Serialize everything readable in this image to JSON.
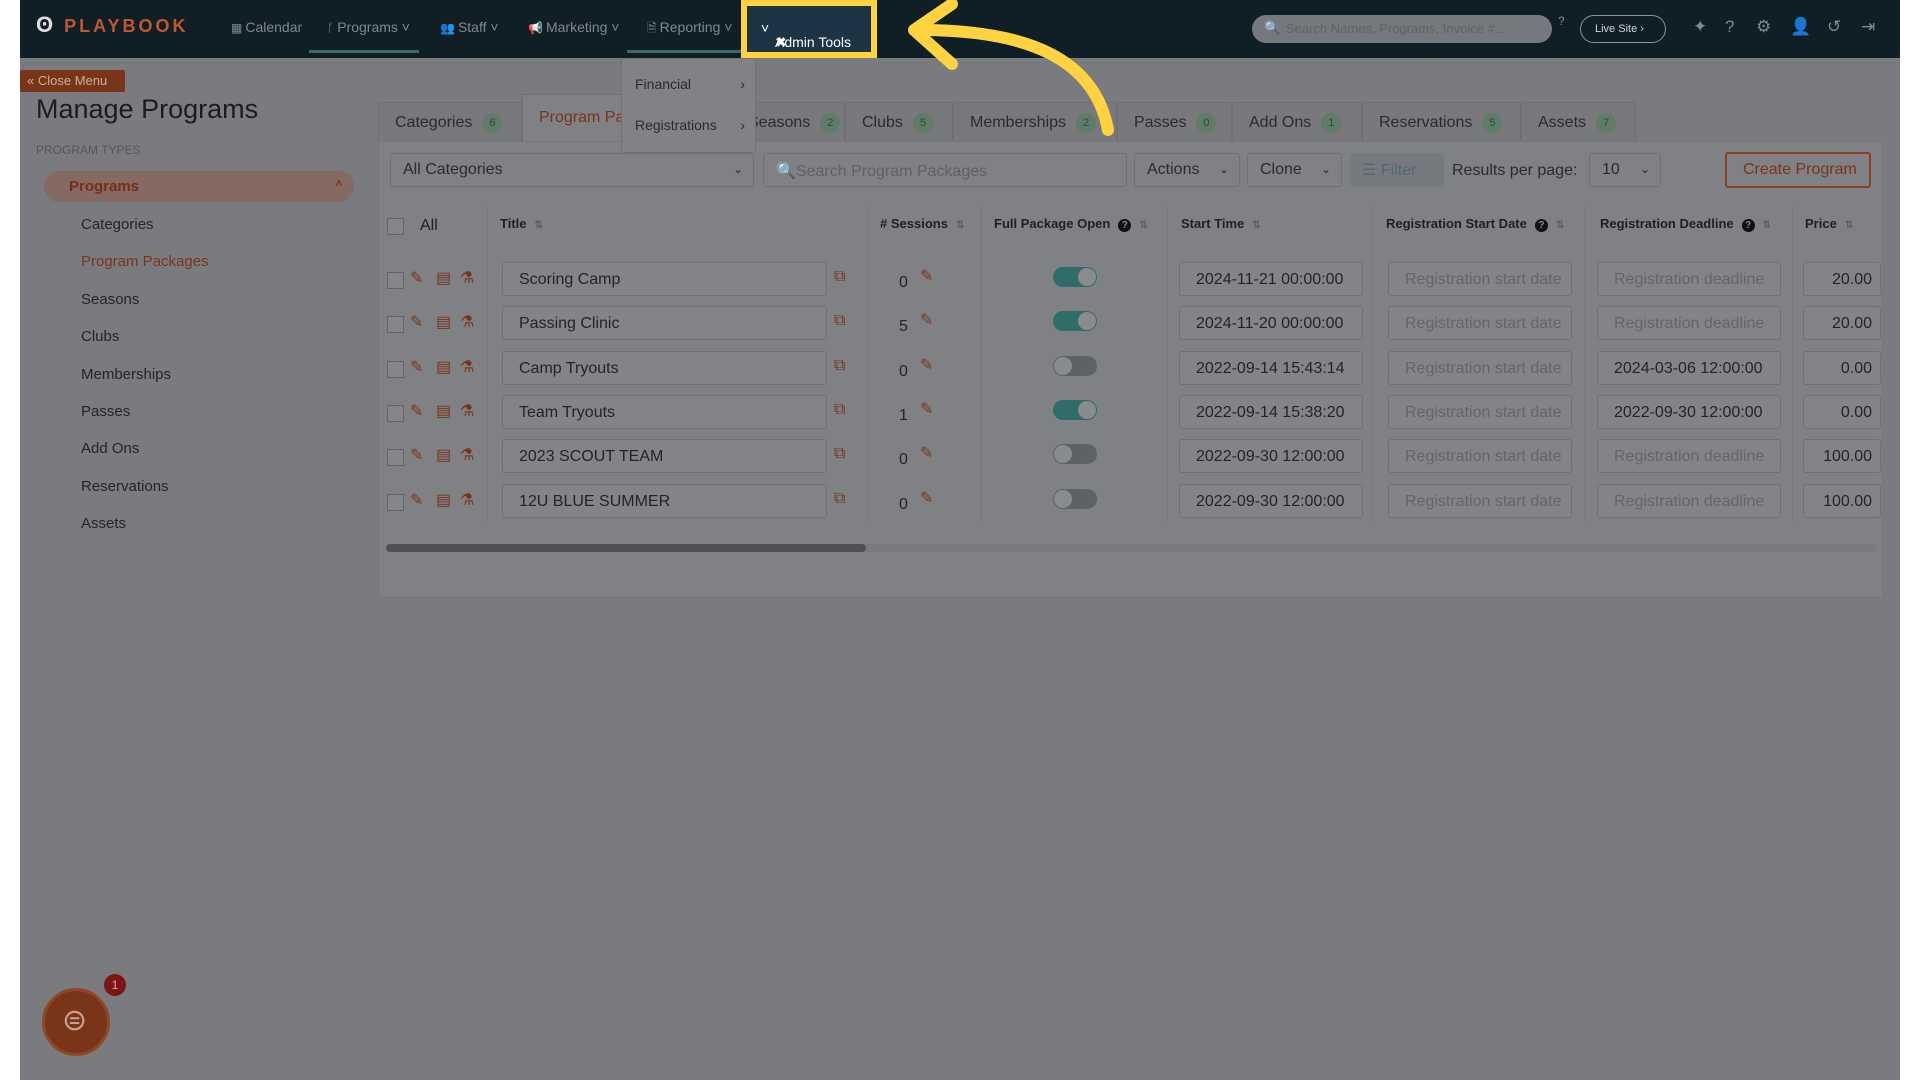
{
  "nav": {
    "logo": "PLAYBOOK",
    "items": [
      {
        "label": "Calendar",
        "icon": "calendar-icon"
      },
      {
        "label": "Programs",
        "icon": "branch-icon"
      },
      {
        "label": "Staff",
        "icon": "users-icon"
      },
      {
        "label": "Marketing",
        "icon": "megaphone-icon"
      },
      {
        "label": "Reporting",
        "icon": "document-icon"
      }
    ],
    "admin_tools": "Admin Tools",
    "search_placeholder": "Search Names, Programs, Invoice #...",
    "live_site": "Live Site"
  },
  "dropdown": {
    "items": [
      "Financial",
      "Registrations"
    ]
  },
  "sidebar": {
    "close_menu": "Close Menu",
    "title": "Manage Programs",
    "section": "PROGRAM TYPES",
    "active": "Programs",
    "items": [
      "Categories",
      "Program Packages",
      "Seasons",
      "Clubs",
      "Memberships",
      "Passes",
      "Add Ons",
      "Reservations",
      "Assets"
    ],
    "selected": "Program Packages"
  },
  "tabs": [
    {
      "label": "Categories",
      "count": "6"
    },
    {
      "label": "Program Packages",
      "count": ""
    },
    {
      "label": "Seasons",
      "count": "2"
    },
    {
      "label": "Clubs",
      "count": "5"
    },
    {
      "label": "Memberships",
      "count": "2"
    },
    {
      "label": "Passes",
      "count": "0"
    },
    {
      "label": "Add Ons",
      "count": "1"
    },
    {
      "label": "Reservations",
      "count": "5"
    },
    {
      "label": "Assets",
      "count": "7"
    }
  ],
  "toolbar": {
    "category": "All Categories",
    "search_placeholder": "Search Program Packages",
    "actions": "Actions",
    "clone": "Clone",
    "filter": "Filter",
    "results_label": "Results per page:",
    "results_value": "10",
    "create": "Create Program"
  },
  "table": {
    "headers": {
      "all": "All",
      "title": "Title",
      "sessions": "# Sessions",
      "full_package": "Full Package Open",
      "start_time": "Start Time",
      "reg_start": "Registration Start Date",
      "reg_deadline": "Registration Deadline",
      "price": "Price"
    },
    "reg_start_placeholder": "Registration start date",
    "reg_deadline_placeholder": "Registration deadline",
    "rows": [
      {
        "title": "Scoring Camp",
        "sessions": "0",
        "open": true,
        "start": "2024-11-21 00:00:00",
        "reg_start": "",
        "reg_deadline": "",
        "price": "20.00"
      },
      {
        "title": "Passing Clinic",
        "sessions": "5",
        "open": true,
        "start": "2024-11-20 00:00:00",
        "reg_start": "",
        "reg_deadline": "",
        "price": "20.00"
      },
      {
        "title": "Camp Tryouts",
        "sessions": "0",
        "open": false,
        "start": "2022-09-14 15:43:14",
        "reg_start": "",
        "reg_deadline": "2024-03-06 12:00:00",
        "price": "0.00"
      },
      {
        "title": "Team Tryouts",
        "sessions": "1",
        "open": true,
        "start": "2022-09-14 15:38:20",
        "reg_start": "",
        "reg_deadline": "2022-09-30 12:00:00",
        "price": "0.00"
      },
      {
        "title": "2023 SCOUT TEAM",
        "sessions": "0",
        "open": false,
        "start": "2022-09-30 12:00:00",
        "reg_start": "",
        "reg_deadline": "",
        "price": "100.00"
      },
      {
        "title": "12U BLUE SUMMER",
        "sessions": "0",
        "open": false,
        "start": "2022-09-30 12:00:00",
        "reg_start": "",
        "reg_deadline": "",
        "price": "100.00"
      }
    ]
  },
  "chat": {
    "badge": "1"
  },
  "colors": {
    "highlight": "#ffd23f",
    "accent": "#c0582a",
    "toggle_on": "#3aa9a0",
    "nav": "#101e26"
  }
}
